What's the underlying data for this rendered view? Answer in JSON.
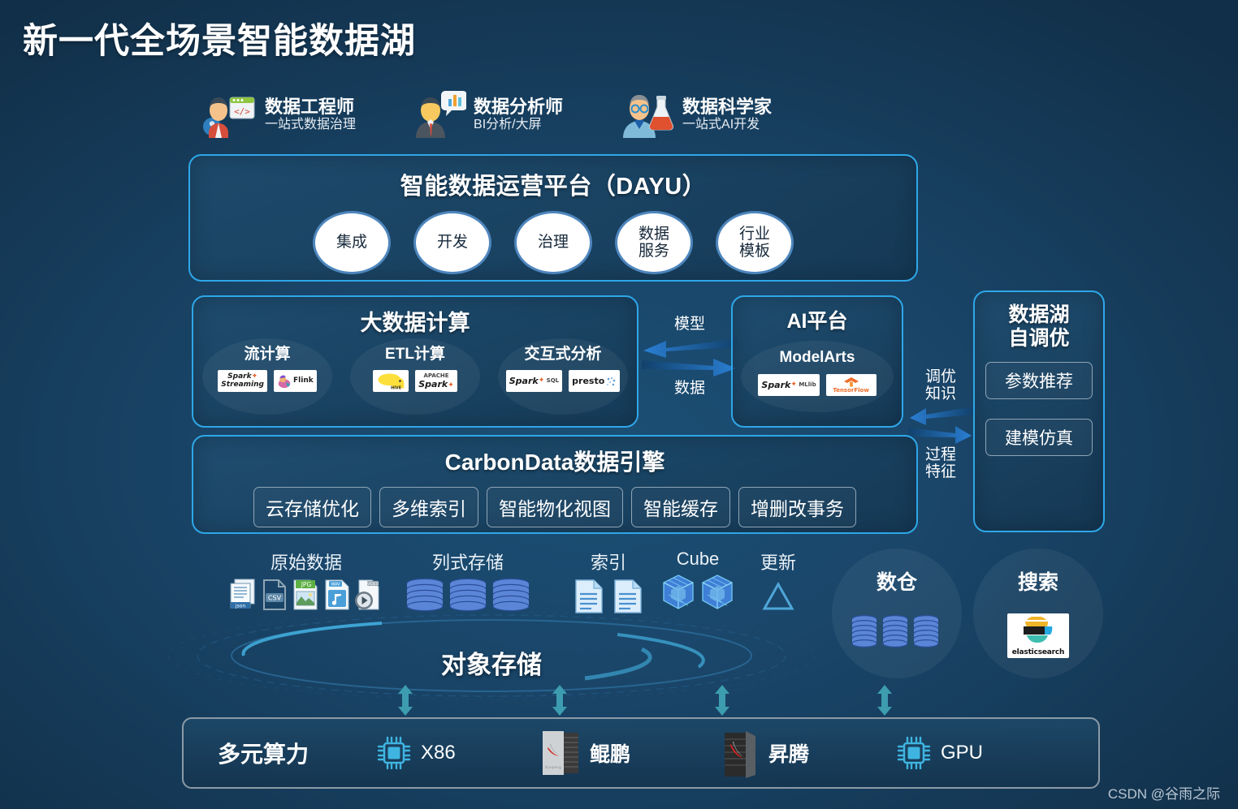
{
  "page_title": "新一代全场景智能数据湖",
  "watermark": "CSDN @谷雨之际",
  "personas": [
    {
      "icon": "data-engineer-icon",
      "title": "数据工程师",
      "subtitle": "一站式数据治理"
    },
    {
      "icon": "data-analyst-icon",
      "title": "数据分析师",
      "subtitle": "BI分析/大屏"
    },
    {
      "icon": "data-scientist-icon",
      "title": "数据科学家",
      "subtitle": "一站式AI开发"
    }
  ],
  "dayu": {
    "title": "智能数据运营平台（DAYU）",
    "capabilities": [
      {
        "label": "集成"
      },
      {
        "label": "开发"
      },
      {
        "label": "治理"
      },
      {
        "label": "数据\n服务",
        "line1": "数据",
        "line2": "服务"
      },
      {
        "label": "行业\n模板",
        "line1": "行业",
        "line2": "模板"
      }
    ]
  },
  "bigdata": {
    "title": "大数据计算",
    "groups": [
      {
        "label": "流计算",
        "logos": [
          "Spark Streaming",
          "Flink"
        ]
      },
      {
        "label": "ETL计算",
        "logos": [
          "HIVE",
          "Apache Spark"
        ]
      },
      {
        "label": "交互式分析",
        "logos": [
          "Spark SQL",
          "presto"
        ]
      }
    ]
  },
  "ai_platform": {
    "title": "AI平台",
    "product": "ModelArts",
    "logos": [
      "Spark MLlib",
      "TensorFlow"
    ]
  },
  "self_tuning": {
    "title_line1": "数据湖",
    "title_line2": "自调优",
    "items": [
      "参数推荐",
      "建模仿真"
    ]
  },
  "carbondata": {
    "title": "CarbonData数据引擎",
    "features": [
      "云存储优化",
      "多维索引",
      "智能物化视图",
      "智能缓存",
      "增删改事务"
    ]
  },
  "arrows": {
    "model_label": "模型",
    "data_label": "数据",
    "tuning_knowledge_line1": "调优",
    "tuning_knowledge_line2": "知识",
    "process_feature_line1": "过程",
    "process_feature_line2": "特征"
  },
  "storage": {
    "object_storage_title": "对象存储",
    "groups": [
      {
        "label": "原始数据",
        "icons": [
          "json-file-icon",
          "csv-file-icon",
          "jpg-file-icon",
          "wav-audio-file-icon",
          "video-file-icon"
        ]
      },
      {
        "label": "列式存储",
        "icons": [
          "columnar-db-icon",
          "columnar-db-icon",
          "columnar-db-icon"
        ]
      },
      {
        "label": "索引",
        "icons": [
          "index-document-icon",
          "index-document-icon"
        ]
      },
      {
        "label": "Cube",
        "icons": [
          "cube-icon",
          "cube-icon"
        ]
      },
      {
        "label": "更新",
        "icons": [
          "delta-triangle-icon"
        ]
      }
    ]
  },
  "right_circles": [
    {
      "label": "数仓",
      "icon": "database-stack-icon"
    },
    {
      "label": "搜索",
      "icon": "elasticsearch-logo",
      "logo_text": "elasticsearch"
    }
  ],
  "compute": {
    "title": "多元算力",
    "items": [
      {
        "label": "X86",
        "icon": "cpu-chip-icon",
        "latin": true
      },
      {
        "label": "鲲鹏",
        "icon": "kunpeng-chip-icon",
        "latin": false
      },
      {
        "label": "昇腾",
        "icon": "ascend-chip-icon",
        "latin": false
      },
      {
        "label": "GPU",
        "icon": "gpu-chip-icon",
        "latin": true
      }
    ]
  },
  "colors": {
    "background": "#16405f",
    "panel_border": "#2ea7e8",
    "accent_blue": "#1f6fc4",
    "teal_arrow": "#3d9cb0",
    "text": "#ffffff"
  }
}
